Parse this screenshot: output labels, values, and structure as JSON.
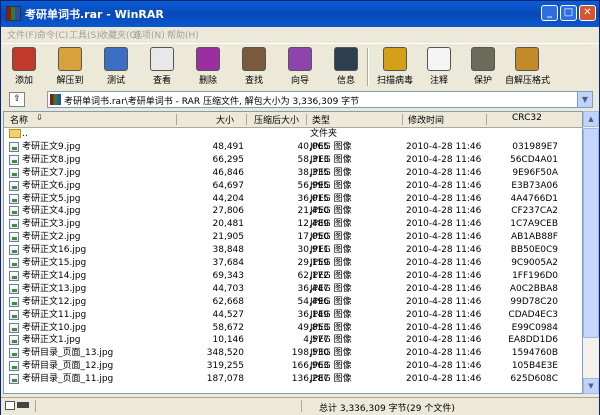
{
  "window": {
    "title": "考研单词书.rar - WinRAR"
  },
  "menu": [
    "文件(F)",
    "命令(C)",
    "工具(S)",
    "收藏夹(O)",
    "选项(N)",
    "帮助(H)"
  ],
  "toolbar": [
    {
      "label": "添加",
      "icon": "add-icon",
      "color": "#c0392b"
    },
    {
      "label": "解压到",
      "icon": "extract-icon",
      "color": "#d8a23a"
    },
    {
      "label": "测试",
      "icon": "test-icon",
      "color": "#3b6fc4"
    },
    {
      "label": "查看",
      "icon": "view-icon",
      "color": "#e8e8e8"
    },
    {
      "label": "删除",
      "icon": "delete-icon",
      "color": "#9b2fa0"
    },
    {
      "label": "查找",
      "icon": "find-icon",
      "color": "#7a5a3a"
    },
    {
      "label": "向导",
      "icon": "wizard-icon",
      "color": "#8e44ad"
    },
    {
      "label": "信息",
      "icon": "info-icon",
      "color": "#2c3e50"
    },
    {
      "label": "扫描病毒",
      "icon": "virus-scan-icon",
      "color": "#d4a017"
    },
    {
      "label": "注释",
      "icon": "comment-icon",
      "color": "#f5f5f5"
    },
    {
      "label": "保护",
      "icon": "protect-icon",
      "color": "#6b6b5a"
    },
    {
      "label": "自解压格式",
      "icon": "sfx-icon",
      "color": "#c28a2a"
    }
  ],
  "address": "考研单词书.rar\\考研单词书 - RAR 压缩文件, 解包大小为 3,336,309 字节",
  "columns": [
    "名称",
    "大小",
    "压缩后大小",
    "类型",
    "修改时间",
    "CRC32"
  ],
  "files": [
    {
      "name": "..",
      "size": "",
      "packed": "",
      "type": "文件夹",
      "date": "",
      "crc": "",
      "folder": true
    },
    {
      "name": "考研正文9.jpg",
      "size": "48,491",
      "packed": "40,065",
      "type": "JPEG 图像",
      "date": "2010-4-28 11:46",
      "crc": "031989E7"
    },
    {
      "name": "考研正文8.jpg",
      "size": "66,295",
      "packed": "58,313",
      "type": "JPEG 图像",
      "date": "2010-4-28 11:46",
      "crc": "56CD4A01"
    },
    {
      "name": "考研正文7.jpg",
      "size": "46,846",
      "packed": "38,335",
      "type": "JPEG 图像",
      "date": "2010-4-28 11:46",
      "crc": "9E96F50A"
    },
    {
      "name": "考研正文6.jpg",
      "size": "64,697",
      "packed": "56,995",
      "type": "JPEG 图像",
      "date": "2010-4-28 11:46",
      "crc": "E3B73A06"
    },
    {
      "name": "考研正文5.jpg",
      "size": "44,204",
      "packed": "36,015",
      "type": "JPEG 图像",
      "date": "2010-4-28 11:46",
      "crc": "4A4766D1"
    },
    {
      "name": "考研正文4.jpg",
      "size": "27,806",
      "packed": "21,450",
      "type": "JPEG 图像",
      "date": "2010-4-28 11:46",
      "crc": "CF237CA2"
    },
    {
      "name": "考研正文3.jpg",
      "size": "20,481",
      "packed": "12,489",
      "type": "JPEG 图像",
      "date": "2010-4-28 11:46",
      "crc": "1C7A9CEB"
    },
    {
      "name": "考研正文2.jpg",
      "size": "21,905",
      "packed": "17,050",
      "type": "JPEG 图像",
      "date": "2010-4-28 11:46",
      "crc": "AB1AB88F"
    },
    {
      "name": "考研正文16.jpg",
      "size": "38,848",
      "packed": "30,911",
      "type": "JPEG 图像",
      "date": "2010-4-28 11:46",
      "crc": "BB50E0C9"
    },
    {
      "name": "考研正文15.jpg",
      "size": "37,684",
      "packed": "29,159",
      "type": "JPEG 图像",
      "date": "2010-4-28 11:46",
      "crc": "9C9005A2"
    },
    {
      "name": "考研正文14.jpg",
      "size": "69,343",
      "packed": "62,172",
      "type": "JPEG 图像",
      "date": "2010-4-28 11:46",
      "crc": "1FF196D0"
    },
    {
      "name": "考研正文13.jpg",
      "size": "44,703",
      "packed": "36,447",
      "type": "JPEG 图像",
      "date": "2010-4-28 11:46",
      "crc": "A0C2BBA8"
    },
    {
      "name": "考研正文12.jpg",
      "size": "62,668",
      "packed": "54,496",
      "type": "JPEG 图像",
      "date": "2010-4-28 11:46",
      "crc": "99D78C20"
    },
    {
      "name": "考研正文11.jpg",
      "size": "44,527",
      "packed": "36,149",
      "type": "JPEG 图像",
      "date": "2010-4-28 11:46",
      "crc": "CDAD4EC3"
    },
    {
      "name": "考研正文10.jpg",
      "size": "58,672",
      "packed": "49,853",
      "type": "JPEG 图像",
      "date": "2010-4-28 11:46",
      "crc": "E99C0984"
    },
    {
      "name": "考研正文1.jpg",
      "size": "10,146",
      "packed": "4,577",
      "type": "JPEG 图像",
      "date": "2010-4-28 11:46",
      "crc": "EA8DD1D6"
    },
    {
      "name": "考研目录_页面_13.jpg",
      "size": "348,520",
      "packed": "198,530",
      "type": "JPEG 图像",
      "date": "2010-4-28 11:46",
      "crc": "1594760B"
    },
    {
      "name": "考研目录_页面_12.jpg",
      "size": "319,255",
      "packed": "166,963",
      "type": "JPEG 图像",
      "date": "2010-4-28 11:46",
      "crc": "105B4E3E"
    },
    {
      "name": "考研目录_页面_11.jpg",
      "size": "187,078",
      "packed": "136,287",
      "type": "JPEG 图像",
      "date": "2010-4-28 11:46",
      "crc": "625D608C"
    }
  ],
  "status": "总计 3,336,309 字节(29 个文件)"
}
